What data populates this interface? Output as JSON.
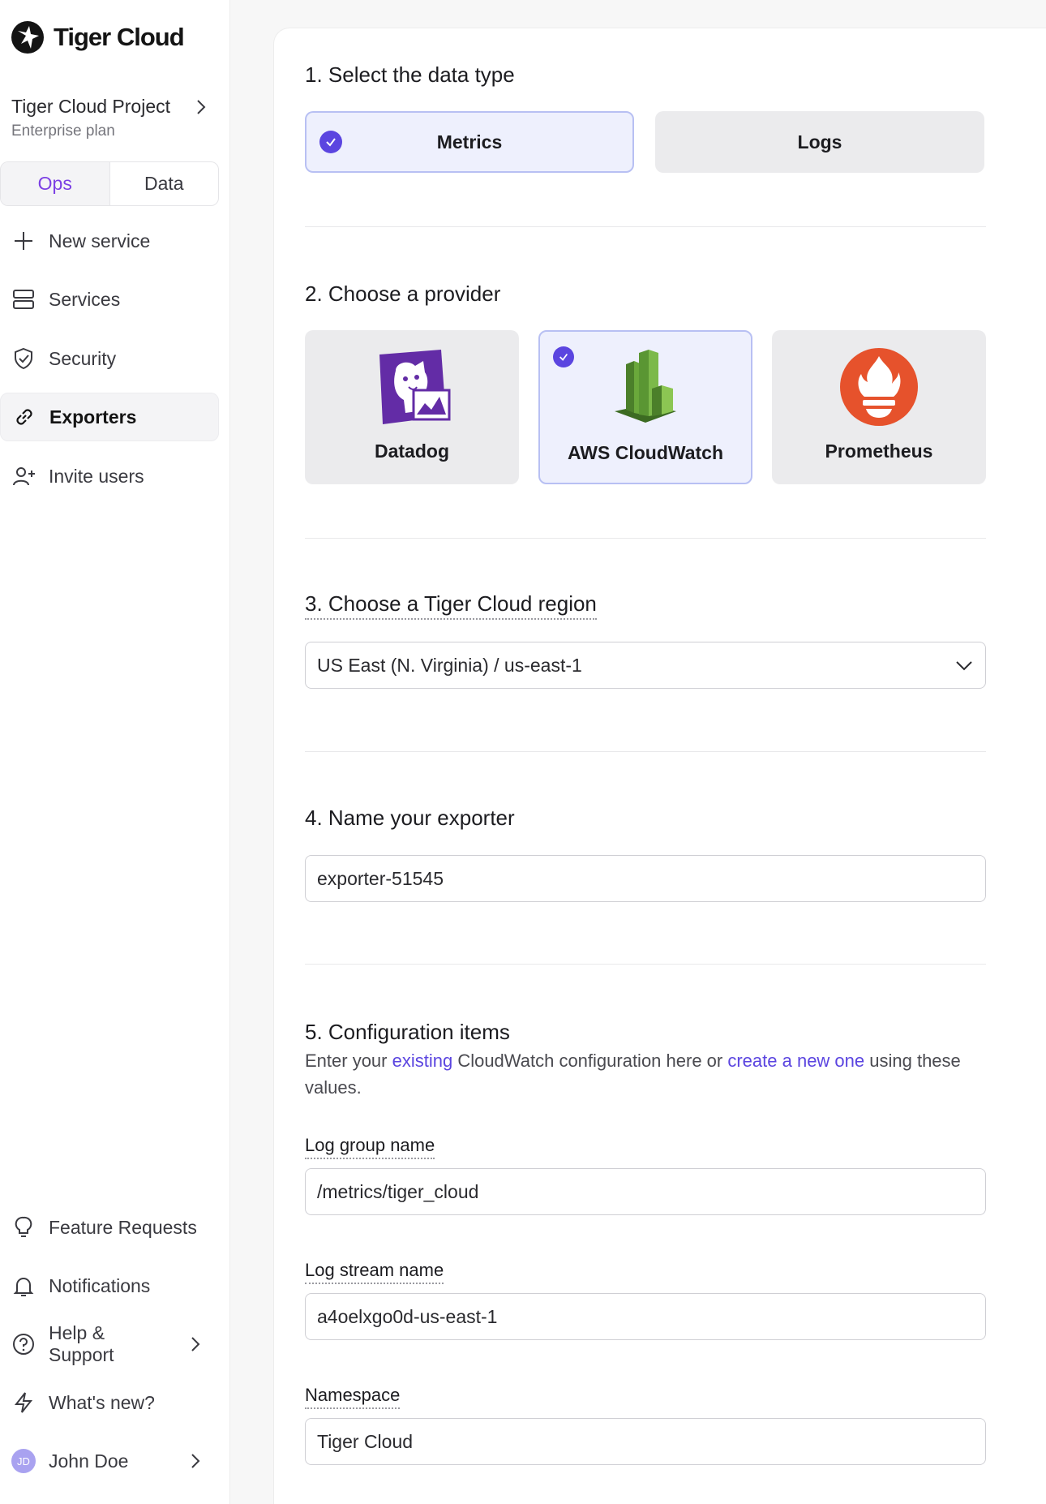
{
  "app": {
    "name": "Tiger Cloud"
  },
  "project": {
    "name": "Tiger Cloud Project",
    "plan": "Enterprise plan"
  },
  "tabs": [
    {
      "label": "Ops",
      "active": true
    },
    {
      "label": "Data",
      "active": false
    }
  ],
  "nav": {
    "new_service": "New service",
    "services": "Services",
    "security": "Security",
    "exporters": "Exporters",
    "invite_users": "Invite users",
    "feature_requests": "Feature Requests",
    "notifications": "Notifications",
    "help_support": "Help & Support",
    "whats_new": "What's new?"
  },
  "user": {
    "name": "John Doe",
    "initials": "JD"
  },
  "form": {
    "step1": {
      "title": "1. Select the data type",
      "options": [
        {
          "label": "Metrics",
          "selected": true
        },
        {
          "label": "Logs",
          "selected": false
        }
      ]
    },
    "step2": {
      "title": "2. Choose a provider",
      "providers": [
        {
          "label": "Datadog",
          "selected": false
        },
        {
          "label": "AWS CloudWatch",
          "selected": true
        },
        {
          "label": "Prometheus",
          "selected": false
        }
      ]
    },
    "step3": {
      "title": "3. Choose a Tiger Cloud region",
      "value": "US East (N. Virginia) / us-east-1"
    },
    "step4": {
      "title": "4. Name your exporter",
      "value": "exporter-51545"
    },
    "step5": {
      "title": "5. Configuration items",
      "desc_prefix": "Enter your ",
      "desc_link1": "existing",
      "desc_middle": " CloudWatch configuration here or ",
      "desc_link2": "create a new one",
      "desc_suffix": " using these values.",
      "log_group_label": "Log group name",
      "log_group_value": "/metrics/tiger_cloud",
      "log_stream_label": "Log stream name",
      "log_stream_value": "a4oelxgo0d-us-east-1",
      "namespace_label": "Namespace",
      "namespace_value": "Tiger Cloud"
    }
  },
  "colors": {
    "accent": "#5b45e0",
    "tab_active": "#7b3fe4",
    "selected_bg": "#eef0fd",
    "selected_border": "#b8c0f3"
  }
}
